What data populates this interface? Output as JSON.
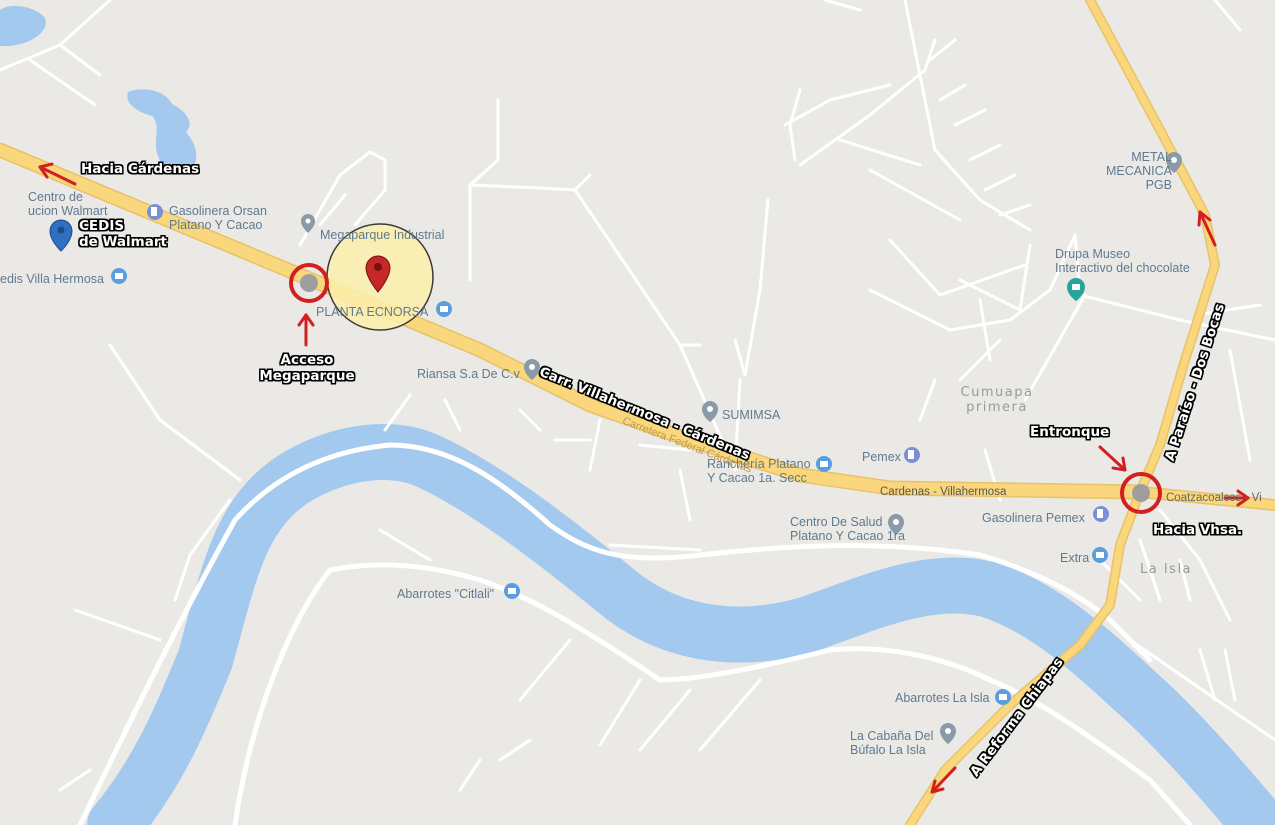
{
  "colors": {
    "land": "#ebe9e6",
    "water": "#a3c9ef",
    "highway": "#fad77d",
    "road": "#ffffff",
    "annotation": "#d21f1f",
    "poi_text": "#5f7a8f",
    "highlight": "#fbeeaa"
  },
  "pois": {
    "centro_walmart": "Centro de\nucion Walmart",
    "cedis_villa": "edis Villa Hermosa",
    "gasolinera_orsan": "Gasolinera Orsan\nPlatano Y Cacao",
    "megaparque": "Megaparque Industrial",
    "planta": "PLANTA ECNORSA",
    "riansa": "Riansa S.a De C.v",
    "sumimsa": "SUMIMSA",
    "rancheria": "Ranchería Platano\nY Cacao 1a. Secc",
    "pemex": "Pemex",
    "centro_salud": "Centro De Salud\nPlatano Y Cacao 1ra",
    "gasolinera_pemex": "Gasolinera Pemex",
    "extra": "Extra",
    "metal": "METAL\nMECANICA PGB",
    "drupa": "Drupa Museo\nInteractivo del chocolate",
    "abarrotes_citlali": "Abarrotes \"Citlali\"",
    "abarrotes_isla": "Abarrotes La Isla",
    "cabana": "La Cabaña Del\nBúfalo La Isla"
  },
  "places": {
    "cumuapa": "Cumuapa\nprimera",
    "la_isla": "La Isla"
  },
  "roads": {
    "cardenas_villahermosa": "Cardenas - Villahermosa",
    "coatzacoalcos": "Coatzacoalcos - Vi",
    "carretera_faded": "Carretera Federal Cárdenas"
  },
  "annotations": {
    "hacia_cardenas": "Hacia Cárdenas",
    "cedis": "CEDIS\nde Walmart",
    "acceso": "Acceso\nMegaparque",
    "carr": "Carr. Villahermosa - Cárdenas",
    "entronque": "Entronque",
    "hacia_vhsa": "Hacia Vhsa.",
    "a_paraiso": "A Paraíso - Dos Bocas",
    "a_reforma": "A Reforma Chiapas"
  },
  "icons": [
    "gas-station-icon",
    "shopping-icon",
    "location-pin-icon",
    "museum-icon",
    "map-marker-icon",
    "arrow-icon",
    "junction-circle-icon"
  ]
}
